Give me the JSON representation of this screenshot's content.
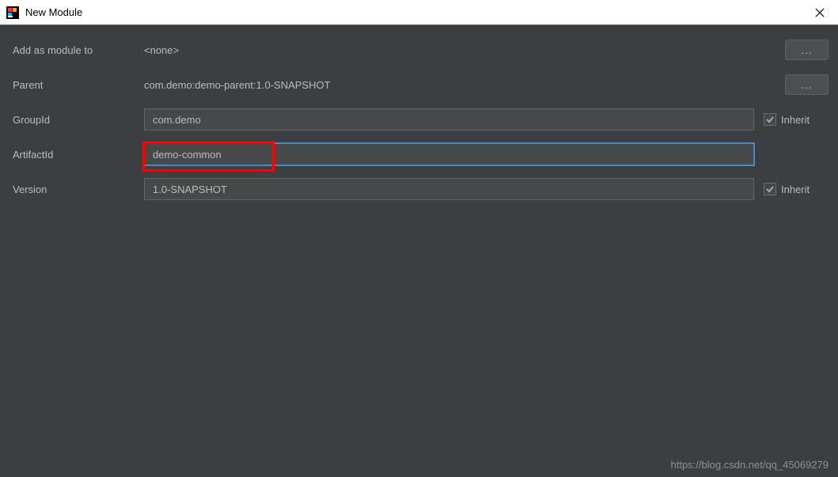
{
  "window": {
    "title": "New Module"
  },
  "form": {
    "addAsModule": {
      "label": "Add as module to",
      "value": "<none>",
      "browse": "..."
    },
    "parent": {
      "label": "Parent",
      "value": "com.demo:demo-parent:1.0-SNAPSHOT",
      "browse": "..."
    },
    "groupId": {
      "label": "GroupId",
      "value": "com.demo",
      "inheritLabel": "Inherit",
      "inheritChecked": true
    },
    "artifactId": {
      "label": "ArtifactId",
      "value": "demo-common"
    },
    "version": {
      "label": "Version",
      "value": "1.0-SNAPSHOT",
      "inheritLabel": "Inherit",
      "inheritChecked": true
    }
  },
  "watermark": "https://blog.csdn.net/qq_45069279"
}
